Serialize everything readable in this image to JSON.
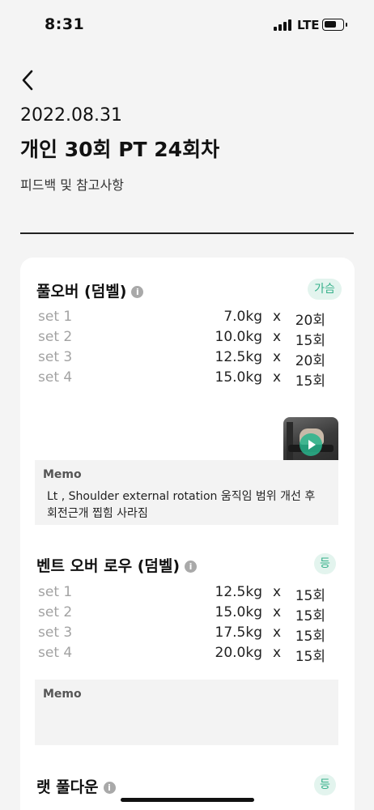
{
  "status_bar": {
    "time": "8:31",
    "network": "LTE"
  },
  "header": {
    "date": "2022.08.31",
    "title": "개인 30회 PT 24회차",
    "section_label": "피드백 및 참고사항"
  },
  "exercises": [
    {
      "name": "풀오버 (덤벨)",
      "tag": "가슴",
      "sets": [
        {
          "label": "set 1",
          "weight": "7.0kg",
          "x": "x",
          "reps": "20회"
        },
        {
          "label": "set 2",
          "weight": "10.0kg",
          "x": "x",
          "reps": "15회"
        },
        {
          "label": "set 3",
          "weight": "12.5kg",
          "x": "x",
          "reps": "20회"
        },
        {
          "label": "set 4",
          "weight": "15.0kg",
          "x": "x",
          "reps": "15회"
        }
      ],
      "memo_label": "Memo",
      "memo_lines": [
        "Lt , Shoulder external rotation 움직임 범위 개선 후",
        "회전근개 찝힘 사라짐"
      ]
    },
    {
      "name": "벤트 오버 로우 (덤벨)",
      "tag": "등",
      "sets": [
        {
          "label": "set 1",
          "weight": "12.5kg",
          "x": "x",
          "reps": "15회"
        },
        {
          "label": "set 2",
          "weight": "15.0kg",
          "x": "x",
          "reps": "15회"
        },
        {
          "label": "set 3",
          "weight": "17.5kg",
          "x": "x",
          "reps": "15회"
        },
        {
          "label": "set 4",
          "weight": "20.0kg",
          "x": "x",
          "reps": "15회"
        }
      ],
      "memo_label": "Memo"
    },
    {
      "name": "랫 풀다운",
      "tag": "등"
    }
  ],
  "icons": {
    "back": "chevron-left-icon",
    "info": "info-icon",
    "play": "play-icon"
  },
  "colors": {
    "tag_bg": "#e3f4ee",
    "tag_text": "#36b08a",
    "set_label": "#a2a2a2",
    "memo_bg": "#f3f3f3"
  }
}
